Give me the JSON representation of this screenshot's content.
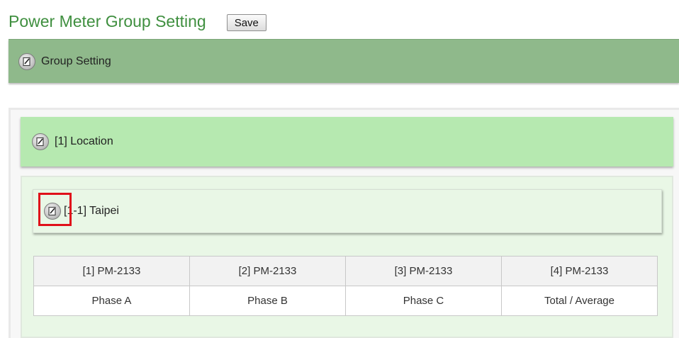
{
  "header": {
    "title": "Power Meter Group Setting",
    "save_label": "Save"
  },
  "group_setting": {
    "label": "Group Setting",
    "icon": "edit-icon"
  },
  "location": {
    "label": "[1] Location",
    "icon": "edit-icon"
  },
  "subgroup": {
    "label": "[1-1] Taipei",
    "icon": "edit-icon",
    "highlight_color": "#e0101a"
  },
  "meters": [
    {
      "name": "[1] PM-2133",
      "phase": "Phase A"
    },
    {
      "name": "[2] PM-2133",
      "phase": "Phase B"
    },
    {
      "name": "[3] PM-2133",
      "phase": "Phase C"
    },
    {
      "name": "[4] PM-2133",
      "phase": "Total / Average"
    }
  ],
  "colors": {
    "title_green": "#3f8f3f",
    "group_header_bg": "#8fb98b",
    "location_header_bg": "#b6e9b0",
    "subgroup_bg": "#e9f7e6"
  }
}
